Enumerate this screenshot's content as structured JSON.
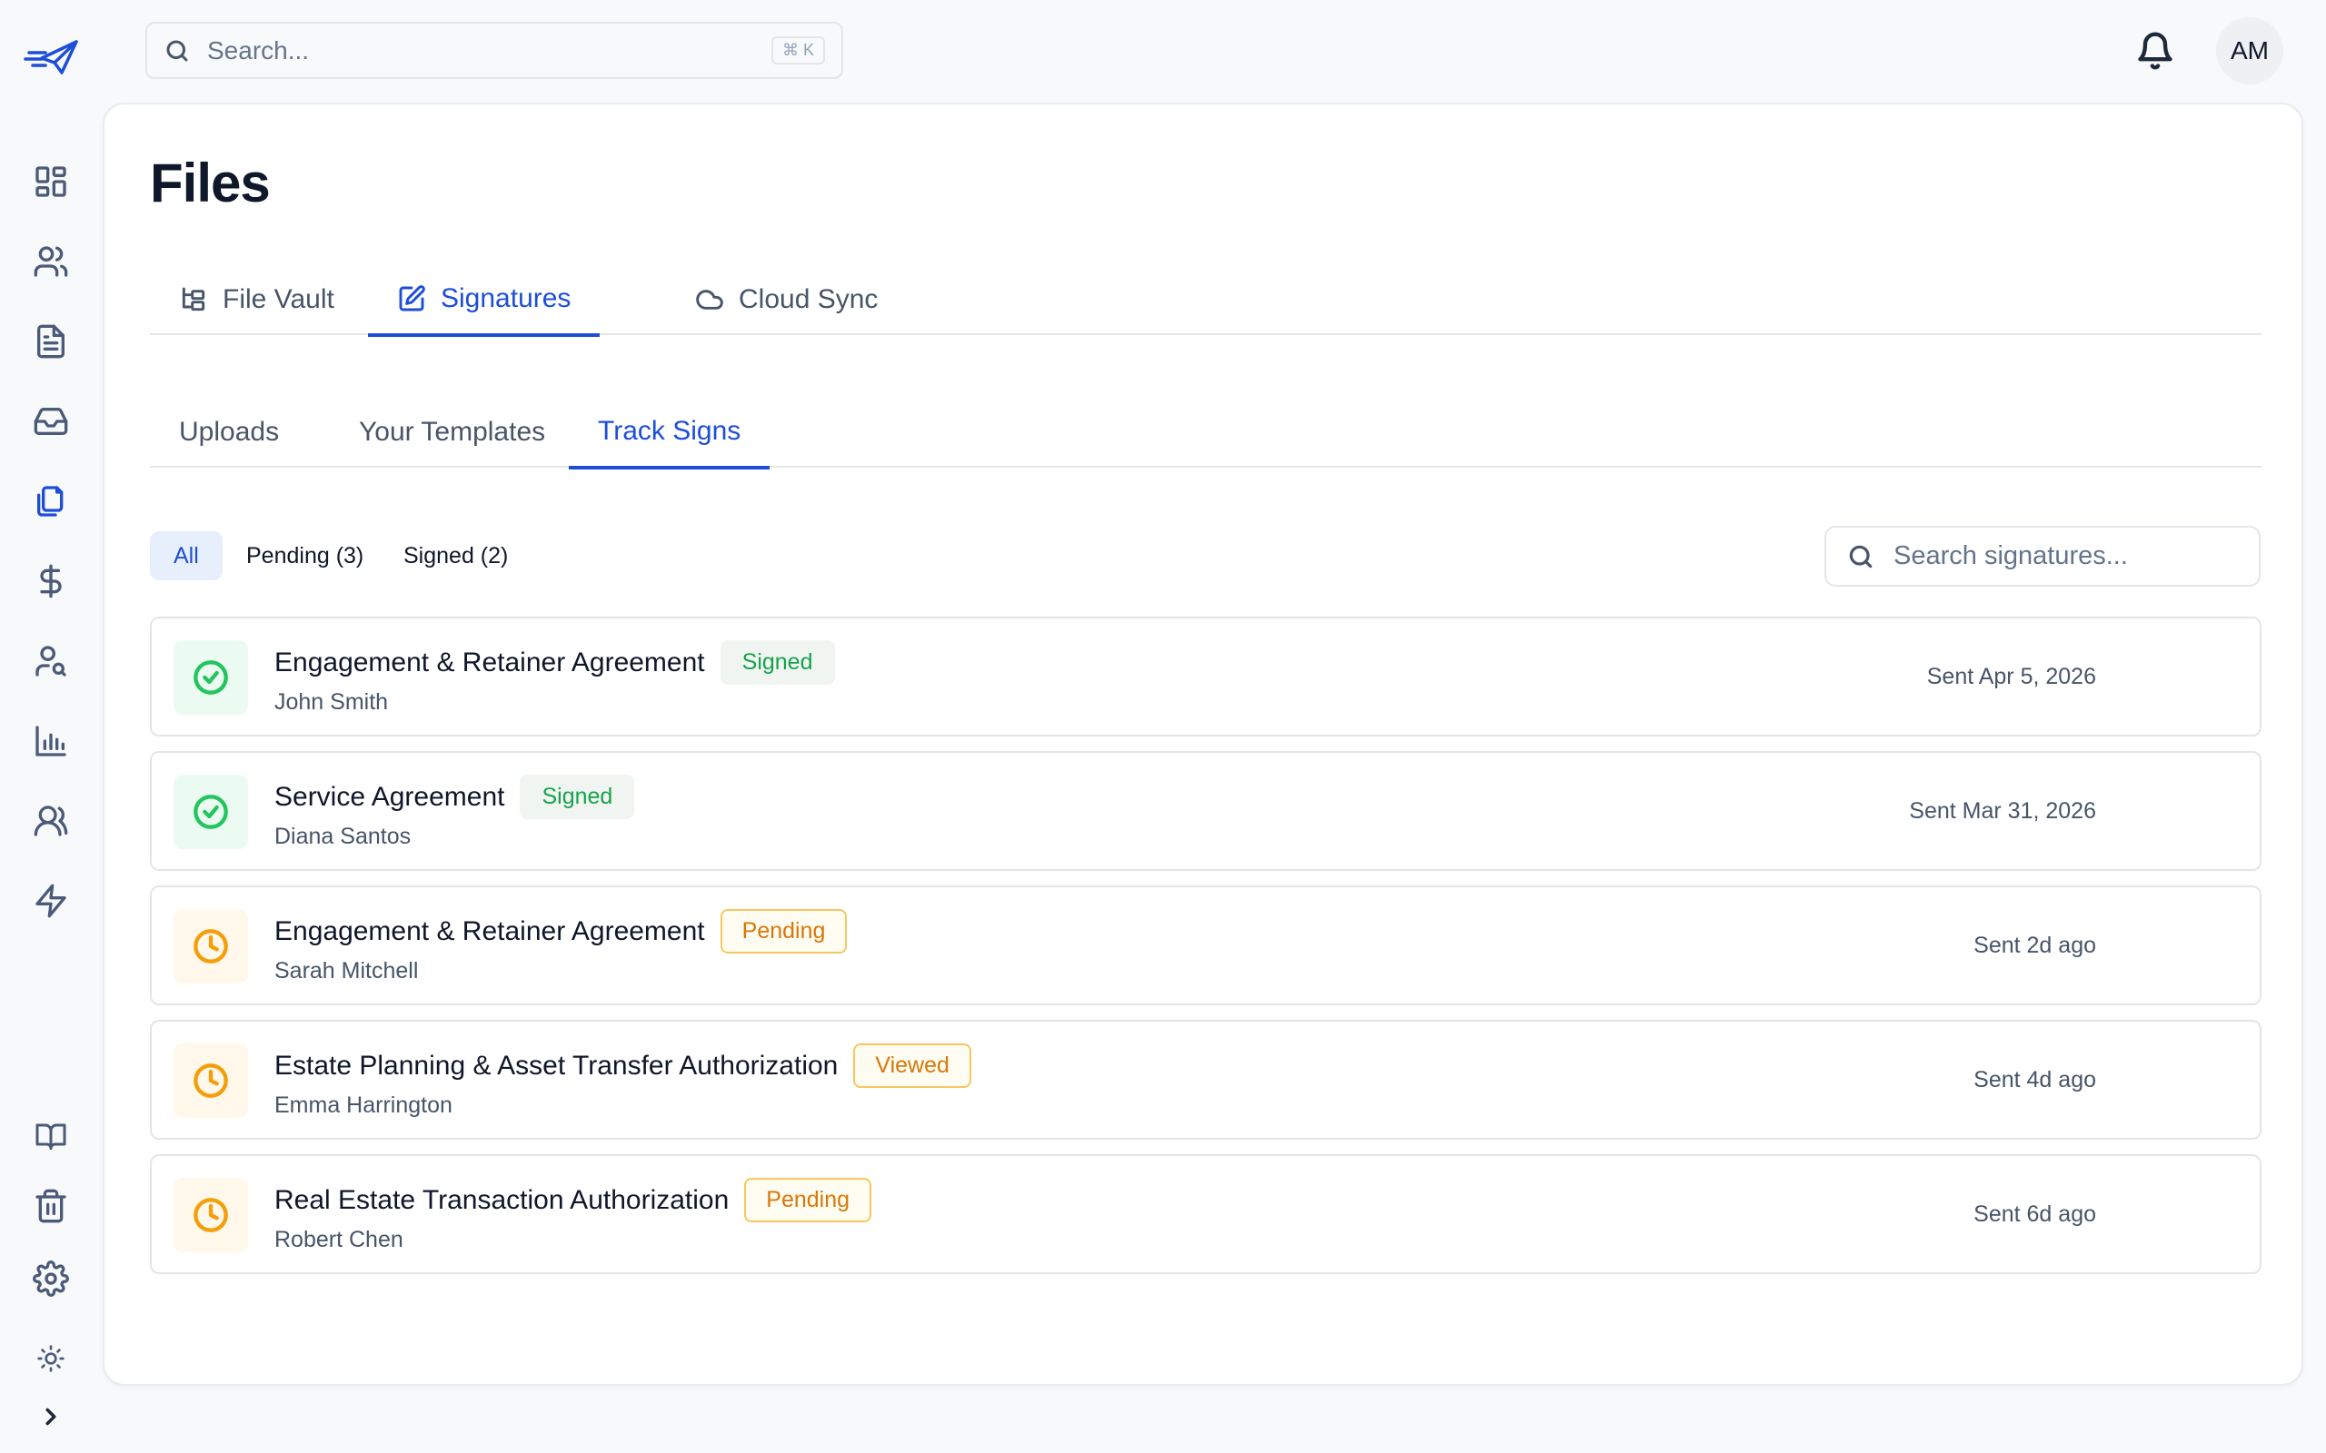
{
  "sidebar": {
    "logo": "paper-plane-logo",
    "items": [
      {
        "name": "dashboard",
        "icon": "dashboard-icon"
      },
      {
        "name": "contacts",
        "icon": "users-icon"
      },
      {
        "name": "documents",
        "icon": "document-icon"
      },
      {
        "name": "inbox",
        "icon": "inbox-icon"
      },
      {
        "name": "files",
        "icon": "files-icon",
        "active": true
      },
      {
        "name": "billing",
        "icon": "dollar-icon"
      },
      {
        "name": "client-search",
        "icon": "user-search-icon"
      },
      {
        "name": "reports",
        "icon": "bar-chart-icon"
      },
      {
        "name": "team",
        "icon": "team-icon"
      },
      {
        "name": "automations",
        "icon": "lightning-icon"
      },
      {
        "name": "guides",
        "icon": "book-icon"
      },
      {
        "name": "trash",
        "icon": "trash-icon"
      },
      {
        "name": "settings",
        "icon": "gear-icon"
      },
      {
        "name": "theme",
        "icon": "sun-icon"
      },
      {
        "name": "expand",
        "icon": "chevron-right-icon"
      }
    ]
  },
  "topbar": {
    "search_placeholder": "Search...",
    "shortcut": "⌘ K",
    "avatar_initials": "AM"
  },
  "page": {
    "title": "Files",
    "tabs": [
      {
        "label": "File Vault",
        "icon": "folder-tree-icon"
      },
      {
        "label": "Signatures",
        "icon": "signature-icon",
        "active": true
      },
      {
        "label": "Cloud Sync",
        "icon": "cloud-icon"
      }
    ],
    "subtabs": [
      {
        "label": "Uploads"
      },
      {
        "label": "Your Templates"
      },
      {
        "label": "Track Signs",
        "active": true
      }
    ],
    "filters": [
      {
        "label": "All",
        "active": true
      },
      {
        "label": "Pending (3)"
      },
      {
        "label": "Signed (2)"
      }
    ],
    "signature_search_placeholder": "Search signatures..."
  },
  "signatures": [
    {
      "document": "Engagement & Retainer Agreement",
      "status": "Signed",
      "status_type": "signed",
      "person": "John Smith",
      "sent": "Sent Apr 5, 2026"
    },
    {
      "document": "Service Agreement",
      "status": "Signed",
      "status_type": "signed",
      "person": "Diana Santos",
      "sent": "Sent Mar 31, 2026"
    },
    {
      "document": "Engagement & Retainer Agreement",
      "status": "Pending",
      "status_type": "pending",
      "person": "Sarah Mitchell",
      "sent": "Sent 2d ago"
    },
    {
      "document": "Estate Planning & Asset Transfer Authorization",
      "status": "Viewed",
      "status_type": "pending",
      "person": "Emma Harrington",
      "sent": "Sent 4d ago"
    },
    {
      "document": "Real Estate Transaction Authorization",
      "status": "Pending",
      "status_type": "pending",
      "person": "Robert Chen",
      "sent": "Sent 6d ago"
    }
  ],
  "colors": {
    "accent": "#1d4ed8",
    "signed": "#16a34a",
    "pending": "#d97706"
  }
}
